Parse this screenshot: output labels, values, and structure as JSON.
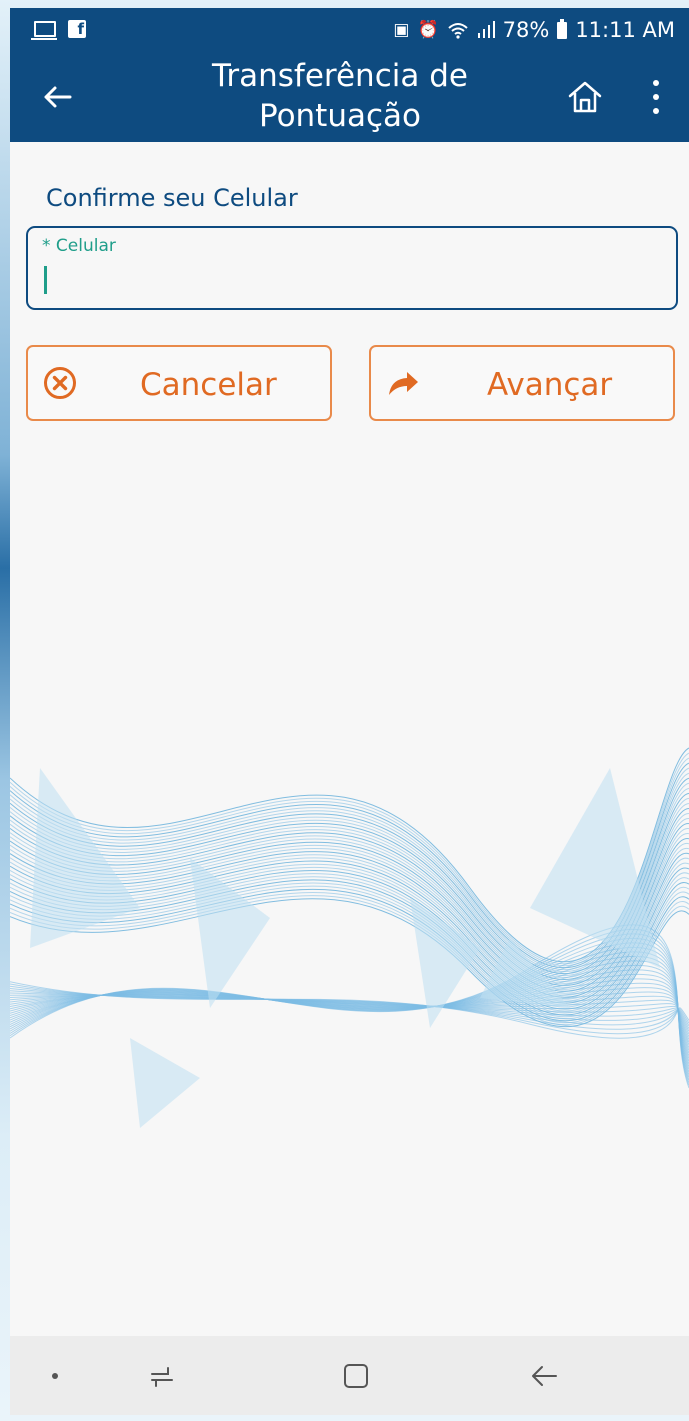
{
  "status_bar": {
    "left_icons": [
      "screen-mirror-icon",
      "facebook-icon"
    ],
    "right_icons": [
      "sim-icon",
      "alarm-icon",
      "wifi-icon",
      "signal-icon",
      "battery-icon"
    ],
    "battery": "78%",
    "time": "11:11 AM"
  },
  "toolbar": {
    "title": "Transferência de Pontuação",
    "back_icon": "back-arrow-icon",
    "home_icon": "home-icon",
    "menu_icon": "more-vertical-icon",
    "color": "#0e4b80"
  },
  "form": {
    "section_title": "Confirme seu Celular",
    "field_label": "* Celular",
    "field_value": "",
    "accent_color": "#1f9e8a"
  },
  "buttons": {
    "cancel_label": "Cancelar",
    "next_label": "Avançar",
    "cancel_icon": "cancel-circle-icon",
    "next_icon": "share-arrow-icon",
    "color": "#e06a23"
  },
  "navigation_bar": {
    "items": [
      "dot-icon",
      "recent-apps-icon",
      "home-square-icon",
      "back-icon"
    ]
  }
}
